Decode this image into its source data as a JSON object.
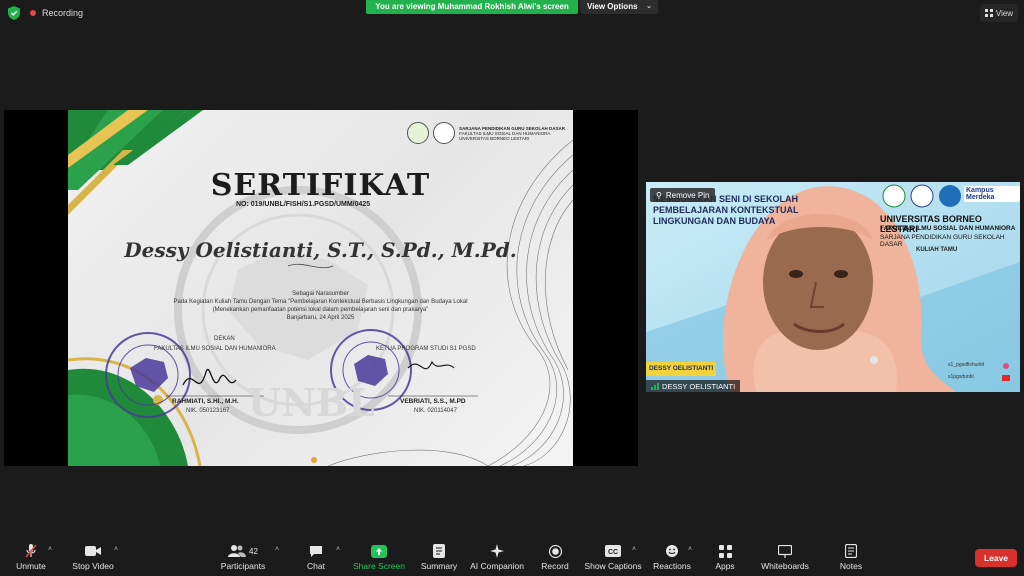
{
  "topbar": {
    "recording_label": "Recording",
    "banner": "You are viewing Muhammad Rokhish Alwi's screen",
    "view_options": "View Options",
    "view": "View"
  },
  "certificate": {
    "title": "SERTIFIKAT",
    "number": "NO: 019/UNBL/FISH/S1.PGSD/UMM/0425",
    "recipient": "Dessy Oelistianti, S.T., S.Pd., M.Pd.",
    "role": "Sebagai Narasumber",
    "line1": "Pada Kegiatan Kuliah Tamu Dengan Tema \"Pembelajaran Kontekstual Berbasis Lingkungan dan Budaya Lokal",
    "line2": "(Menekankan pemanfaatan potensi lokal dalam pembelajaran seni dan prakarya\"",
    "place_date": "Banjarbaru, 24 April 2025",
    "left_title_1": "DEKAN",
    "left_title_2": "FAKULTAS ILMU SOSIAL DAN HUMANIORA",
    "left_name": "RAHMIATI, S.HI., M.H.",
    "left_nik": "NIK. 050123167",
    "right_title": "KETUA PROGRAM STUDI S1 PGSD",
    "right_name": "VEBRIATI, S.S., M.PD",
    "right_nik": "NIK. 020114047",
    "header_org_1": "SARJANA PENDIDIKAN GURU SEKOLAH DASAR",
    "header_org_2": "FAKULTAS ILMU SOSIAL DAN HUMANIORA",
    "header_org_3": "UNIVERSITAS BORNEO LESTARI",
    "watermark": "UNBL"
  },
  "video": {
    "remove_pin": "Remove Pin",
    "participant_name": "DESSY OELISTIANTI",
    "bg_university": "UNIVERSITAS BORNEO LESTARI",
    "bg_faculty": "FAKULTAS ILMU SOSIAL DAN HUMANIORA",
    "bg_program": "SARJANA PENDIDIKAN GURU SEKOLAH DASAR",
    "bg_event": "KULIAH TAMU",
    "bg_kampus": "Kampus Merdeka",
    "bg_slide_1": "MEMBUMIKAN SENI DI SEKOLAH",
    "bg_slide_2": "PEMBELAJARAN KONTEKSTUAL",
    "bg_slide_3": "LINGKUNGAN DAN BUDAYA",
    "bg_banner": "DESSY OELISTIANTI",
    "bg_social_1": "s1_pgsdfishunbl",
    "bg_social_2": "s1pgsdunbl"
  },
  "toolbar": {
    "unmute": "Unmute",
    "stop_video": "Stop Video",
    "participants": "Participants",
    "participants_count": "42",
    "chat": "Chat",
    "share_screen": "Share Screen",
    "summary": "Summary",
    "ai_companion": "AI Companion",
    "record": "Record",
    "show_captions": "Show Captions",
    "reactions": "Reactions",
    "apps": "Apps",
    "whiteboards": "Whiteboards",
    "notes": "Notes",
    "leave": "Leave"
  },
  "colors": {
    "accent_green": "#23b14d",
    "leave_red": "#d9322d",
    "cert_green": "#1f8a3a",
    "cert_gold": "#d8b54a"
  }
}
